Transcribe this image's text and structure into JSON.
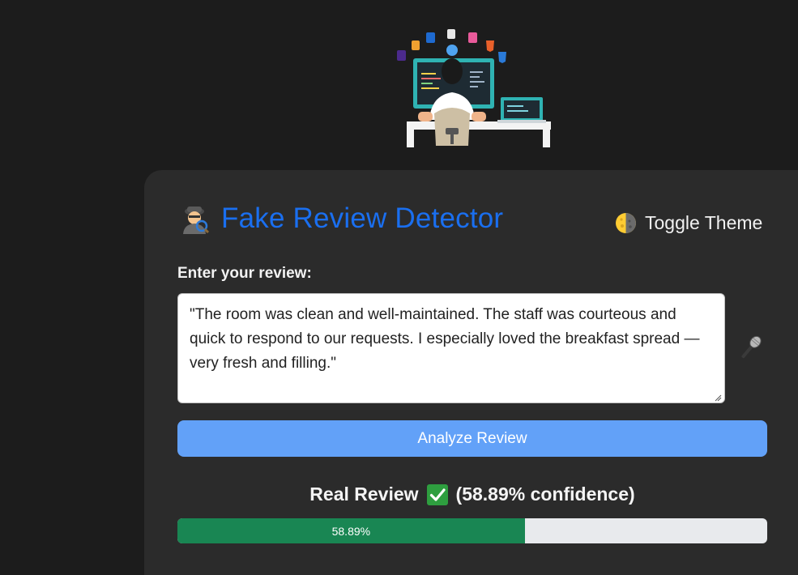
{
  "app": {
    "title": "Fake Review Detector",
    "toggle_label": "Toggle Theme"
  },
  "form": {
    "label": "Enter your review:",
    "review_text": "\"The room was clean and well-maintained. The staff was courteous and quick to respond to our requests. I especially loved the breakfast spread — very fresh and filling.\"",
    "analyze_label": "Analyze Review"
  },
  "result": {
    "verdict": "Real Review",
    "confidence_text": "(58.89% confidence)",
    "progress_label": "58.89%",
    "progress_fraction": 0.5889
  },
  "icons": {
    "title": "detective-icon",
    "toggle": "half-moon-icon",
    "mic": "microphone-icon",
    "verdict": "check-mark-icon"
  },
  "colors": {
    "title": "#1a6ff0",
    "button": "#62a1f8",
    "progress": "#198653",
    "card": "#2b2b2b",
    "page": "#1c1c1c"
  }
}
